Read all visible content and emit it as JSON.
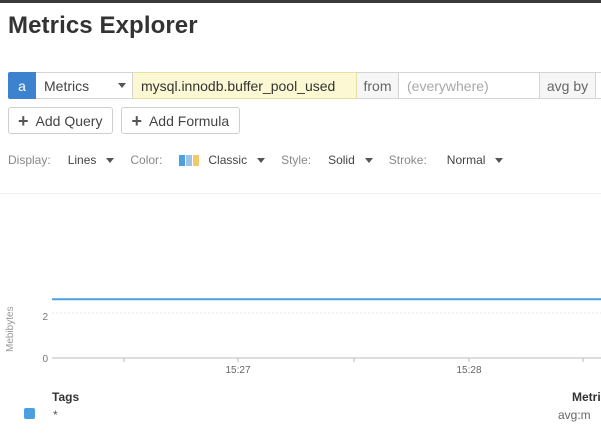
{
  "page": {
    "title": "Metrics Explorer"
  },
  "query": {
    "letter": "a",
    "source": "Metrics",
    "metric": "mysql.innodb.buffer_pool_used",
    "from_label": "from",
    "scope_placeholder": "(everywhere)",
    "avg_by_label": "avg by"
  },
  "buttons": {
    "add_query": "Add Query",
    "add_formula": "Add Formula"
  },
  "display": {
    "display_label": "Display:",
    "display_value": "Lines",
    "color_label": "Color:",
    "color_value": "Classic",
    "style_label": "Style:",
    "style_value": "Solid",
    "stroke_label": "Stroke:",
    "stroke_value": "Normal",
    "palette_colors": [
      "#4c9fe0",
      "#9ec3e8",
      "#f2c86b"
    ]
  },
  "chart_data": {
    "type": "line",
    "ylabel": "Mebibytes",
    "yticks": [
      "0",
      "2"
    ],
    "xticks": [
      "15:27",
      "15:28"
    ],
    "series": [
      {
        "values": [
          2.8,
          2.8,
          2.8,
          2.8
        ]
      }
    ],
    "ylim": [
      0,
      3
    ],
    "line_color": "#4c9fe0"
  },
  "legend": {
    "tags_header": "Tags",
    "metric_header": "Metri",
    "rows": [
      {
        "tag": "*",
        "metric": "avg:m",
        "color": "#4c9fe0"
      }
    ]
  }
}
